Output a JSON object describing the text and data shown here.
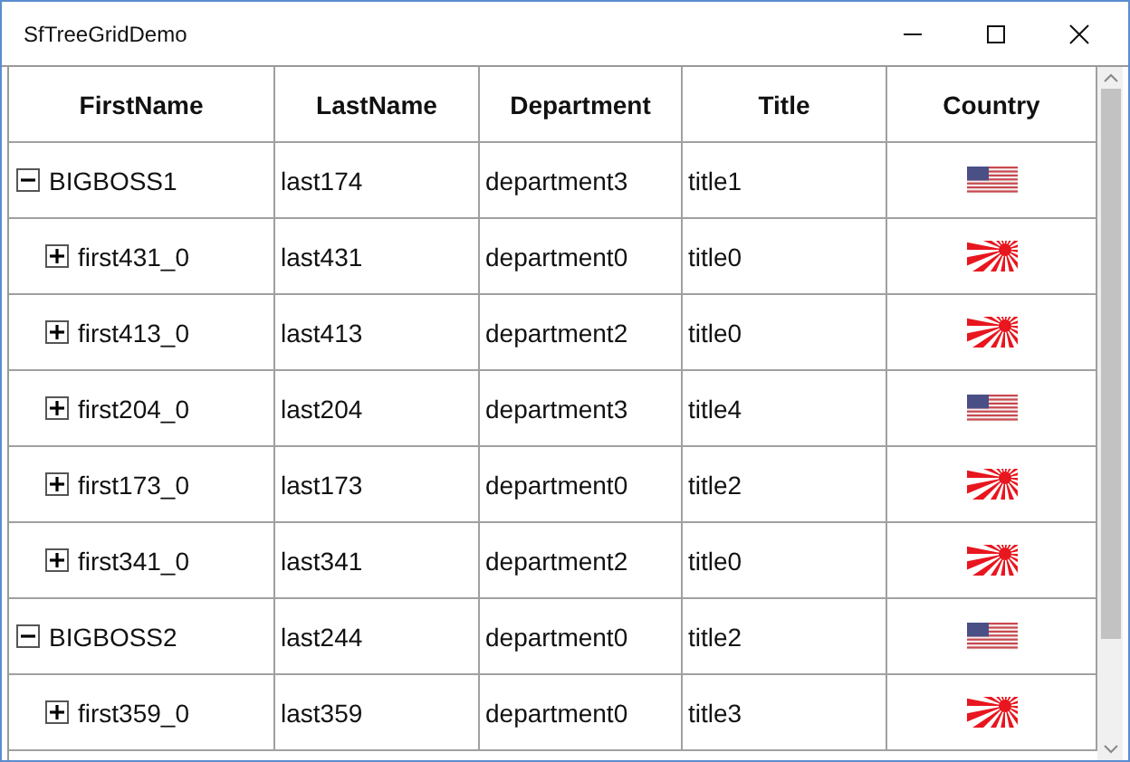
{
  "window": {
    "title": "SfTreeGridDemo"
  },
  "table": {
    "columns": [
      "FirstName",
      "LastName",
      "Department",
      "Title",
      "Country"
    ],
    "rows": [
      {
        "first_name": "BIGBOSS1",
        "last_name": "last174",
        "department": "department3",
        "title": "title1",
        "kind": "us",
        "expanded": true,
        "children": [
          {
            "first_name": "first431_0",
            "last_name": "last431",
            "department": "department0",
            "title": "title0",
            "kind": "sun",
            "expanded": false
          },
          {
            "first_name": "first413_0",
            "last_name": "last413",
            "department": "department2",
            "title": "title0",
            "kind": "sun",
            "expanded": false
          },
          {
            "first_name": "first204_0",
            "last_name": "last204",
            "department": "department3",
            "title": "title4",
            "kind": "us",
            "expanded": false
          },
          {
            "first_name": "first173_0",
            "last_name": "last173",
            "department": "department0",
            "title": "title2",
            "kind": "sun",
            "expanded": false
          },
          {
            "first_name": "first341_0",
            "last_name": "last341",
            "department": "department2",
            "title": "title0",
            "kind": "sun",
            "expanded": false
          }
        ]
      },
      {
        "first_name": "BIGBOSS2",
        "last_name": "last244",
        "department": "department0",
        "title": "title2",
        "kind": "us",
        "expanded": true,
        "children": [
          {
            "first_name": "first359_0",
            "last_name": "last359",
            "department": "department0",
            "title": "title3",
            "kind": "sun",
            "expanded": false
          }
        ]
      }
    ]
  }
}
